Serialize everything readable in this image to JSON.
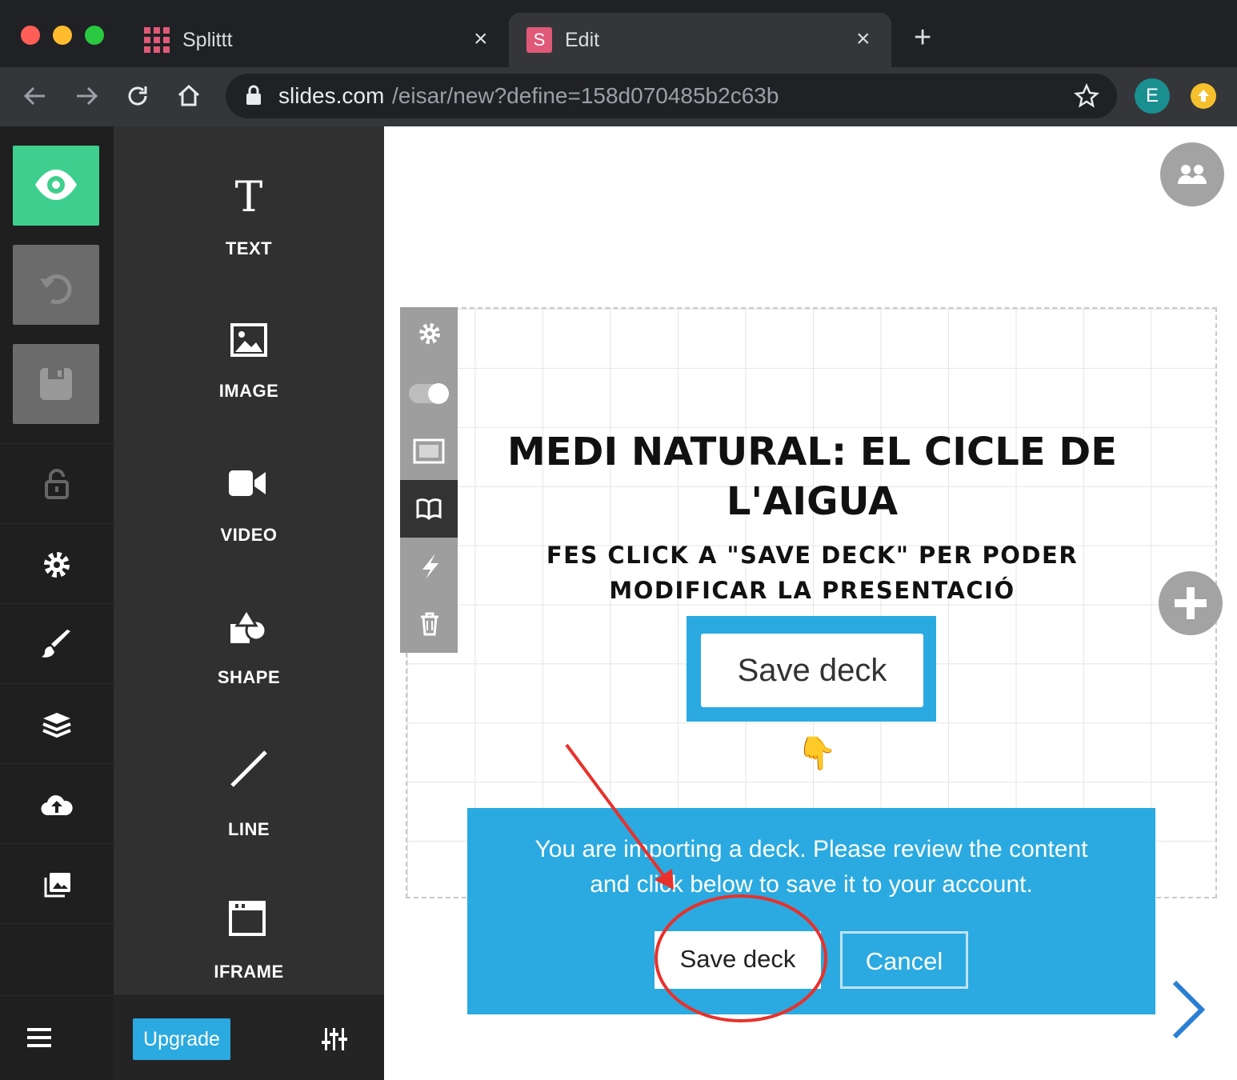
{
  "browser": {
    "tabs": [
      {
        "title": "Splittt",
        "icon": "grid-favicon",
        "active": false
      },
      {
        "title": "Edit",
        "favicon_letter": "S",
        "active": true
      }
    ],
    "new_tab_label": "+",
    "close_glyph": "×",
    "url": {
      "domain": "slides.com",
      "path": "/eisar/new?define=158d070485b2c63b"
    },
    "profile_initial": "E",
    "colors": {
      "frame": "#202124",
      "toolbar": "#35363a",
      "profile": "#1a8f8f",
      "favicon": "#e05a78"
    }
  },
  "rail": {
    "buttons": [
      "preview",
      "undo",
      "save"
    ],
    "icons": [
      "lock",
      "settings",
      "brush",
      "layers",
      "cloud-upload",
      "media"
    ],
    "colors": {
      "preview": "#3ecf8e",
      "disabled": "#6b6b6b"
    }
  },
  "tools": [
    {
      "label": "TEXT",
      "icon": "text-icon"
    },
    {
      "label": "IMAGE",
      "icon": "image-icon"
    },
    {
      "label": "VIDEO",
      "icon": "video-icon"
    },
    {
      "label": "SHAPE",
      "icon": "shape-icon"
    },
    {
      "label": "LINE",
      "icon": "line-icon"
    },
    {
      "label": "IFRAME",
      "icon": "iframe-icon"
    }
  ],
  "footer": {
    "upgrade_label": "Upgrade"
  },
  "slide": {
    "title_line1": "MEDI NATURAL: EL CICLE DE",
    "title_line2": "L'AIGUA",
    "subtitle_line1": "FES CLICK A \"SAVE DECK\" PER PODER",
    "subtitle_line2": "MODIFICAR LA PRESENTACIÓ",
    "save_button_label": "Save deck",
    "pointer_emoji": "👇"
  },
  "dialog": {
    "message_line1": "You are importing a deck. Please review the content",
    "message_line2": "and click below to save it to your account.",
    "save_label": "Save deck",
    "cancel_label": "Cancel",
    "colors": {
      "background": "#2aaae0",
      "annotation": "#e8312b"
    }
  }
}
